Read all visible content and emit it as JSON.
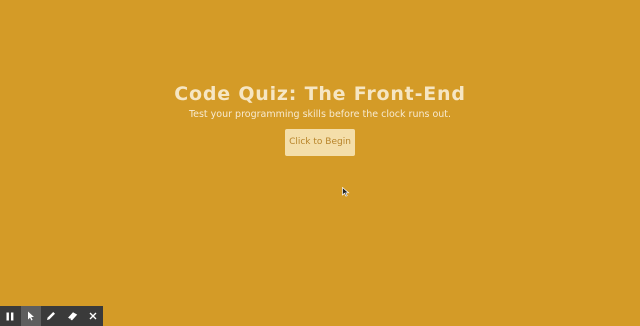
{
  "page": {
    "background_color": "#d49b27"
  },
  "hero": {
    "title": "Code Quiz: The Front-End",
    "subtitle": "Test your programming skills before the clock runs out.",
    "begin_button": "Click to Begin"
  },
  "annotation_toolbar": {
    "tools": [
      {
        "icon": "pause-icon",
        "active": false
      },
      {
        "icon": "pointer-icon",
        "active": true
      },
      {
        "icon": "pencil-icon",
        "active": false
      },
      {
        "icon": "eraser-icon",
        "active": false
      },
      {
        "icon": "close-icon",
        "active": false
      }
    ]
  }
}
